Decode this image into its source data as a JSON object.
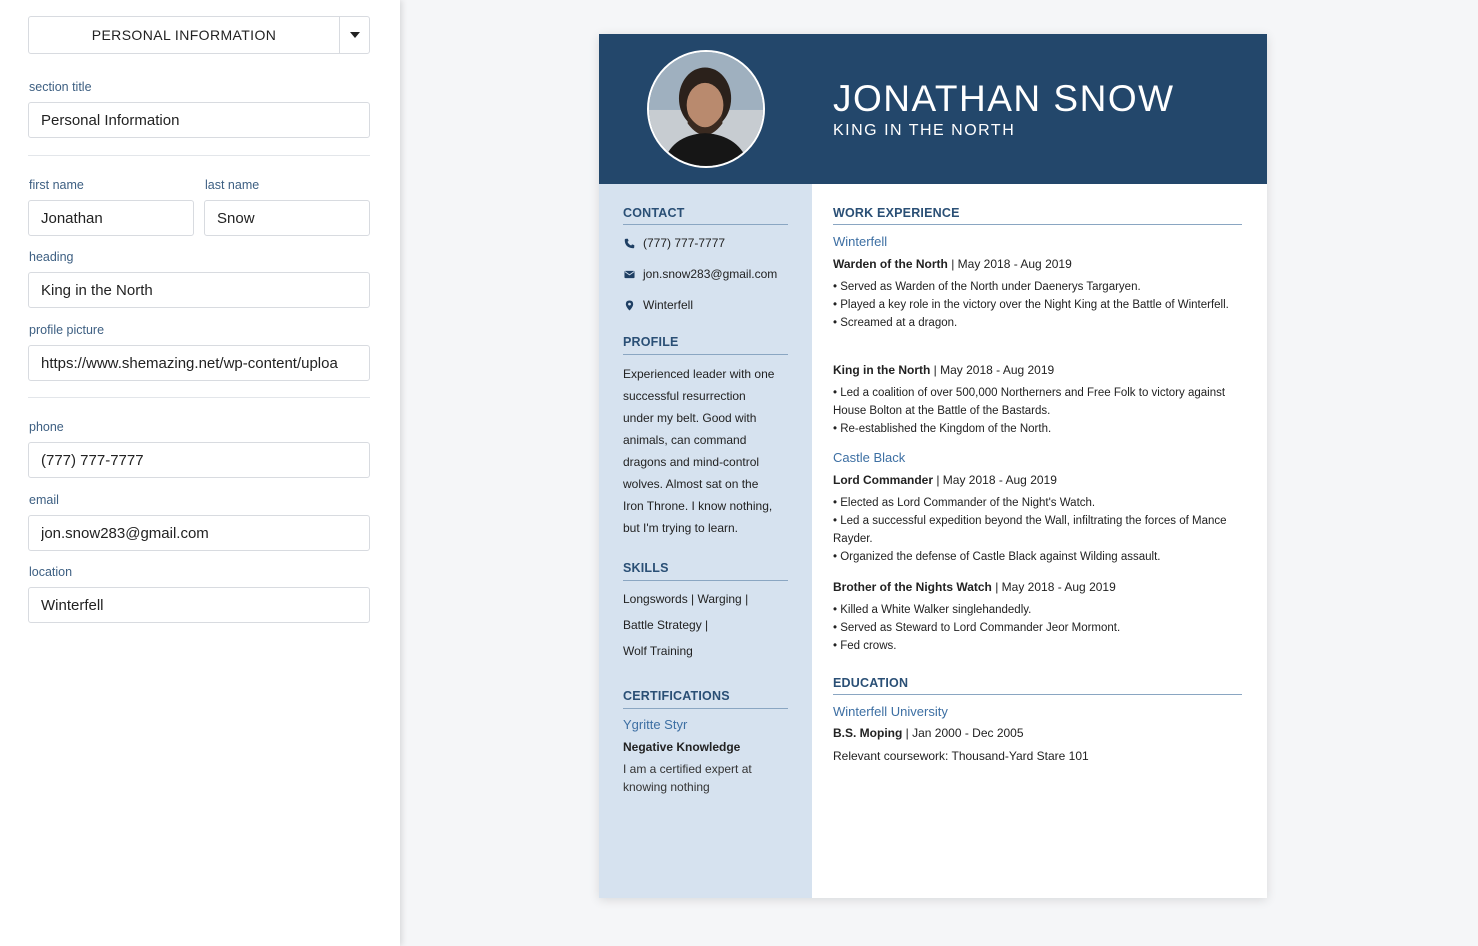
{
  "editor": {
    "section_select": "PERSONAL INFORMATION",
    "fields": {
      "section_title": {
        "label": "section title",
        "value": "Personal Information"
      },
      "first_name": {
        "label": "first name",
        "value": "Jonathan"
      },
      "last_name": {
        "label": "last name",
        "value": "Snow"
      },
      "heading": {
        "label": "heading",
        "value": "King in the North"
      },
      "profile_picture": {
        "label": "profile picture",
        "value": "https://www.shemazing.net/wp-content/uploa"
      },
      "phone": {
        "label": "phone",
        "value": "(777) 777-7777"
      },
      "email": {
        "label": "email",
        "value": "jon.snow283@gmail.com"
      },
      "location": {
        "label": "location",
        "value": "Winterfell"
      }
    }
  },
  "resume": {
    "name": "JONATHAN SNOW",
    "heading": "KING IN THE NORTH",
    "colors": {
      "header": "#23476b",
      "sidebar": "#d6e2ef",
      "accent": "#3d6fa3"
    },
    "contact": {
      "title": "CONTACT",
      "phone": "(777) 777-7777",
      "email": "jon.snow283@gmail.com",
      "location": "Winterfell",
      "icons": [
        "phone-icon",
        "email-icon",
        "location-pin-icon"
      ]
    },
    "profile": {
      "title": "PROFILE",
      "lines": [
        "Experienced leader with one",
        "successful resurrection",
        "under my belt. Good with",
        "animals, can command",
        "dragons and mind-control",
        "wolves. Almost sat on the",
        "Iron Throne. I know nothing,",
        "but I'm trying to learn."
      ]
    },
    "skills": {
      "title": "SKILLS",
      "lines": [
        "Longswords | Warging |",
        "Battle Strategy |",
        "Wolf Training"
      ]
    },
    "certifications": {
      "title": "CERTIFICATIONS",
      "issuer": "Ygritte Styr",
      "name": "Negative Knowledge",
      "desc": [
        "I am a certified expert at",
        "knowing nothing"
      ]
    },
    "work": {
      "title": "WORK EXPERIENCE",
      "org1": "Winterfell",
      "job1": {
        "role": "Warden of the North",
        "dates": " | May 2018 - Aug 2019",
        "bullets": [
          "• Served as Warden of the North under Daenerys Targaryen.",
          "• Played a key role in the victory over the Night King at the Battle of Winterfell.",
          "• Screamed at a dragon."
        ]
      },
      "job2": {
        "role": "King in the North",
        "dates": " | May 2018 - Aug 2019",
        "bullets": [
          "• Led a coalition of over 500,000 Northerners and Free Folk to victory against House Bolton at the Battle of the Bastards.",
          "• Re-established the Kingdom of the North."
        ]
      },
      "org2": "Castle Black",
      "job3": {
        "role": "Lord Commander",
        "dates": " | May 2018 - Aug 2019",
        "bullets": [
          "• Elected as Lord Commander of the Night's Watch.",
          "• Led a successful expedition beyond the Wall, infiltrating the forces of Mance Rayder.",
          "• Organized the defense of Castle Black against Wilding assault."
        ]
      },
      "job4": {
        "role": "Brother of the Nights Watch",
        "dates": " | May 2018 - Aug 2019",
        "bullets": [
          "• Killed a White Walker singlehandedly.",
          "• Served as Steward to Lord Commander Jeor Mormont.",
          "• Fed crows."
        ]
      }
    },
    "education": {
      "title": "EDUCATION",
      "school": "Winterfell University",
      "degree": "B.S. Moping",
      "dates": " | Jan 2000 - Dec 2005",
      "coursework": "Relevant coursework: Thousand-Yard Stare 101"
    }
  }
}
